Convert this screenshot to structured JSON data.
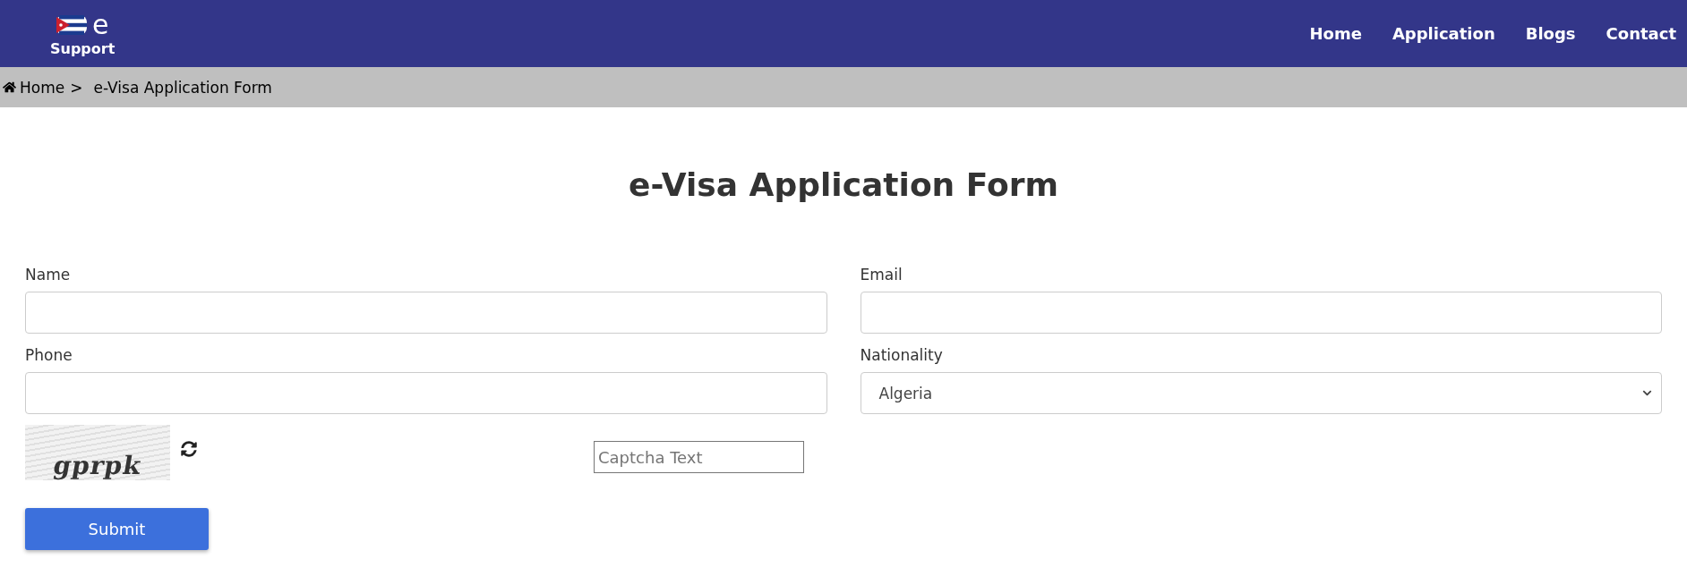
{
  "logo": {
    "letter": "e",
    "caption": "Support"
  },
  "nav": [
    {
      "label": "Home"
    },
    {
      "label": "Application"
    },
    {
      "label": "Blogs"
    },
    {
      "label": "Contact"
    }
  ],
  "breadcrumb": {
    "home": "Home",
    "separator": ">",
    "current": "e-Visa Application Form"
  },
  "title": "e-Visa Application Form",
  "fields": [
    {
      "label": "Name",
      "kind": "text"
    },
    {
      "label": "Email",
      "kind": "text"
    },
    {
      "label": "Phone",
      "kind": "text"
    },
    {
      "label": "Nationality",
      "kind": "select",
      "value": "Algeria"
    }
  ],
  "captcha": {
    "code": "gprpk",
    "placeholder": "Captcha Text"
  },
  "submit": "Submit"
}
